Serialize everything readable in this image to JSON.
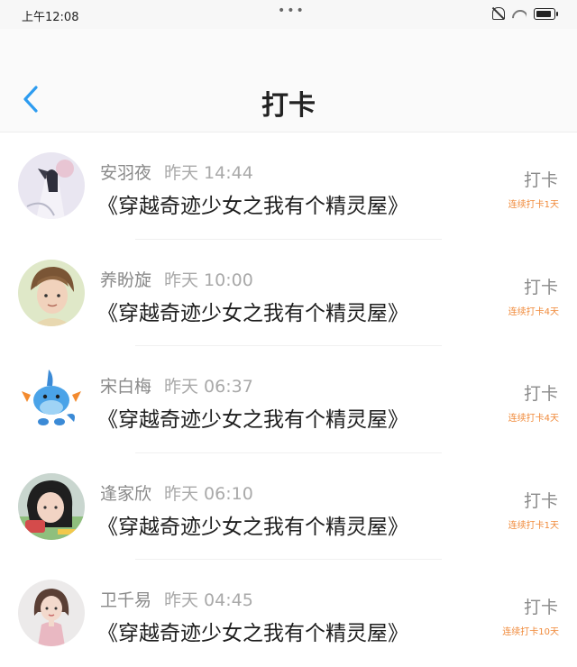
{
  "status_bar": {
    "time": "上午12:08",
    "dots": "•••"
  },
  "nav": {
    "title": "打卡"
  },
  "colors": {
    "accent_blue": "#2d9cf0",
    "streak_orange": "#f08a3a"
  },
  "items": [
    {
      "name": "安羽夜",
      "date": "昨天 14:44",
      "book": "《穿越奇迹少女之我有个精灵屋》",
      "action": "打卡",
      "streak": "连续打卡1天",
      "avatar": "ink-painting-avatar"
    },
    {
      "name": "养盼旋",
      "date": "昨天 10:00",
      "book": "《穿越奇迹少女之我有个精灵屋》",
      "action": "打卡",
      "streak": "连续打卡4天",
      "avatar": "portrait-avatar"
    },
    {
      "name": "宋白梅",
      "date": "昨天 06:37",
      "book": "《穿越奇迹少女之我有个精灵屋》",
      "action": "打卡",
      "streak": "连续打卡4天",
      "avatar": "blue-creature-avatar"
    },
    {
      "name": "逢家欣",
      "date": "昨天 06:10",
      "book": "《穿越奇迹少女之我有个精灵屋》",
      "action": "打卡",
      "streak": "连续打卡1天",
      "avatar": "photo-avatar"
    },
    {
      "name": "卫千易",
      "date": "昨天 04:45",
      "book": "《穿越奇迹少女之我有个精灵屋》",
      "action": "打卡",
      "streak": "连续打卡10天",
      "avatar": "girl-avatar"
    }
  ]
}
